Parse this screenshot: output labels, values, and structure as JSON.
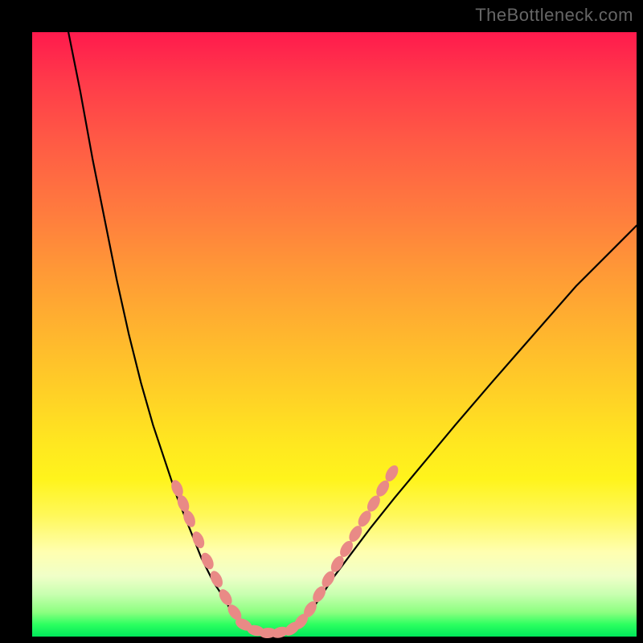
{
  "watermark": "TheBottleneck.com",
  "colors": {
    "frame_bg": "#000000",
    "curve_stroke": "#000000",
    "marker_fill": "#e98a86",
    "marker_stroke": "#d97874"
  },
  "chart_data": {
    "type": "line",
    "title": "",
    "xlabel": "",
    "ylabel": "",
    "xlim": [
      0,
      100
    ],
    "ylim": [
      0,
      100
    ],
    "grid": false,
    "legend": false,
    "annotations": [
      "TheBottleneck.com"
    ],
    "series": [
      {
        "name": "left-branch",
        "x": [
          6,
          8,
          10,
          12,
          14,
          16,
          18,
          20,
          22,
          24,
          26,
          28,
          30,
          32,
          33,
          34,
          35
        ],
        "y": [
          100,
          90,
          79,
          69,
          59,
          50,
          42,
          35,
          29,
          23,
          18,
          13,
          9,
          6,
          4,
          3,
          2
        ]
      },
      {
        "name": "valley-floor",
        "x": [
          35,
          36,
          37,
          38,
          39,
          40,
          41,
          42,
          43,
          44
        ],
        "y": [
          2,
          1.2,
          0.8,
          0.6,
          0.5,
          0.5,
          0.6,
          0.8,
          1.2,
          2
        ]
      },
      {
        "name": "right-branch",
        "x": [
          44,
          46,
          48,
          50,
          53,
          56,
          60,
          65,
          70,
          76,
          83,
          90,
          98,
          100
        ],
        "y": [
          2,
          4,
          7,
          10,
          14,
          18,
          23,
          29,
          35,
          42,
          50,
          58,
          66,
          68
        ]
      }
    ],
    "markers": {
      "name": "highlight-segments",
      "points": [
        {
          "x": 24.0,
          "y": 24.5
        },
        {
          "x": 25.0,
          "y": 22.0
        },
        {
          "x": 26.0,
          "y": 19.5
        },
        {
          "x": 27.5,
          "y": 16.0
        },
        {
          "x": 29.0,
          "y": 12.5
        },
        {
          "x": 30.5,
          "y": 9.5
        },
        {
          "x": 32.0,
          "y": 6.5
        },
        {
          "x": 33.5,
          "y": 4.0
        },
        {
          "x": 35.0,
          "y": 2.0
        },
        {
          "x": 37.0,
          "y": 1.0
        },
        {
          "x": 39.0,
          "y": 0.6
        },
        {
          "x": 41.0,
          "y": 0.7
        },
        {
          "x": 43.0,
          "y": 1.3
        },
        {
          "x": 44.5,
          "y": 2.5
        },
        {
          "x": 46.0,
          "y": 4.5
        },
        {
          "x": 47.5,
          "y": 7.0
        },
        {
          "x": 49.0,
          "y": 9.5
        },
        {
          "x": 50.5,
          "y": 12.0
        },
        {
          "x": 52.0,
          "y": 14.5
        },
        {
          "x": 53.5,
          "y": 17.0
        },
        {
          "x": 55.0,
          "y": 19.5
        },
        {
          "x": 56.5,
          "y": 22.0
        },
        {
          "x": 58.0,
          "y": 24.5
        },
        {
          "x": 59.5,
          "y": 27.0
        }
      ]
    }
  }
}
